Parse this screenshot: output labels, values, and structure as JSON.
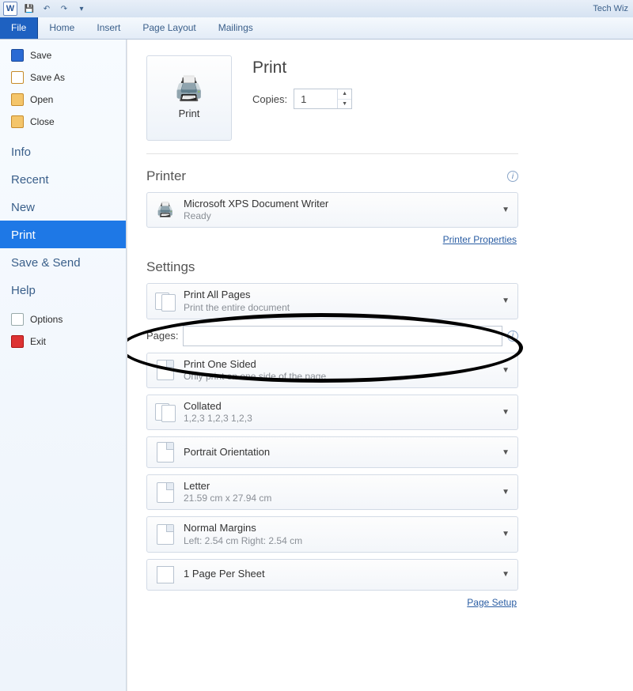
{
  "titlebar": {
    "doc_title": "Tech Wiz"
  },
  "ribbon": {
    "file": "File",
    "tabs": [
      "Home",
      "Insert",
      "Page Layout",
      "Mailings"
    ]
  },
  "backstage_nav": {
    "top": [
      {
        "label": "Save",
        "icon": "save-icon"
      },
      {
        "label": "Save As",
        "icon": "save-as-icon"
      },
      {
        "label": "Open",
        "icon": "open-icon"
      },
      {
        "label": "Close",
        "icon": "close-file-icon"
      }
    ],
    "mid": [
      "Info",
      "Recent",
      "New",
      "Print",
      "Save & Send",
      "Help"
    ],
    "active": "Print",
    "bottom": [
      {
        "label": "Options",
        "icon": "options-icon"
      },
      {
        "label": "Exit",
        "icon": "exit-icon"
      }
    ]
  },
  "print_panel": {
    "big_button": "Print",
    "heading": "Print",
    "copies_label": "Copies:",
    "copies_value": "1",
    "printer_section": "Printer",
    "printer": {
      "title": "Microsoft XPS Document Writer",
      "sub": "Ready"
    },
    "printer_properties": "Printer Properties",
    "settings_section": "Settings",
    "settings": [
      {
        "title": "Print All Pages",
        "sub": "Print the entire document",
        "icon": "pages-icon"
      },
      {
        "title": "Print One Sided",
        "sub": "Only print on one side of the page",
        "icon": "page-icon"
      },
      {
        "title": "Collated",
        "sub": "1,2,3    1,2,3    1,2,3",
        "icon": "collate-icon"
      },
      {
        "title": "Portrait Orientation",
        "sub": "",
        "icon": "portrait-icon"
      },
      {
        "title": "Letter",
        "sub": "21.59 cm x 27.94 cm",
        "icon": "letter-icon"
      },
      {
        "title": "Normal Margins",
        "sub": "Left:  2.54 cm    Right:  2.54 cm",
        "icon": "margins-icon"
      },
      {
        "title": "1 Page Per Sheet",
        "sub": "",
        "icon": "sheet-icon"
      }
    ],
    "pages_label": "Pages:",
    "pages_value": "",
    "page_setup": "Page Setup"
  }
}
